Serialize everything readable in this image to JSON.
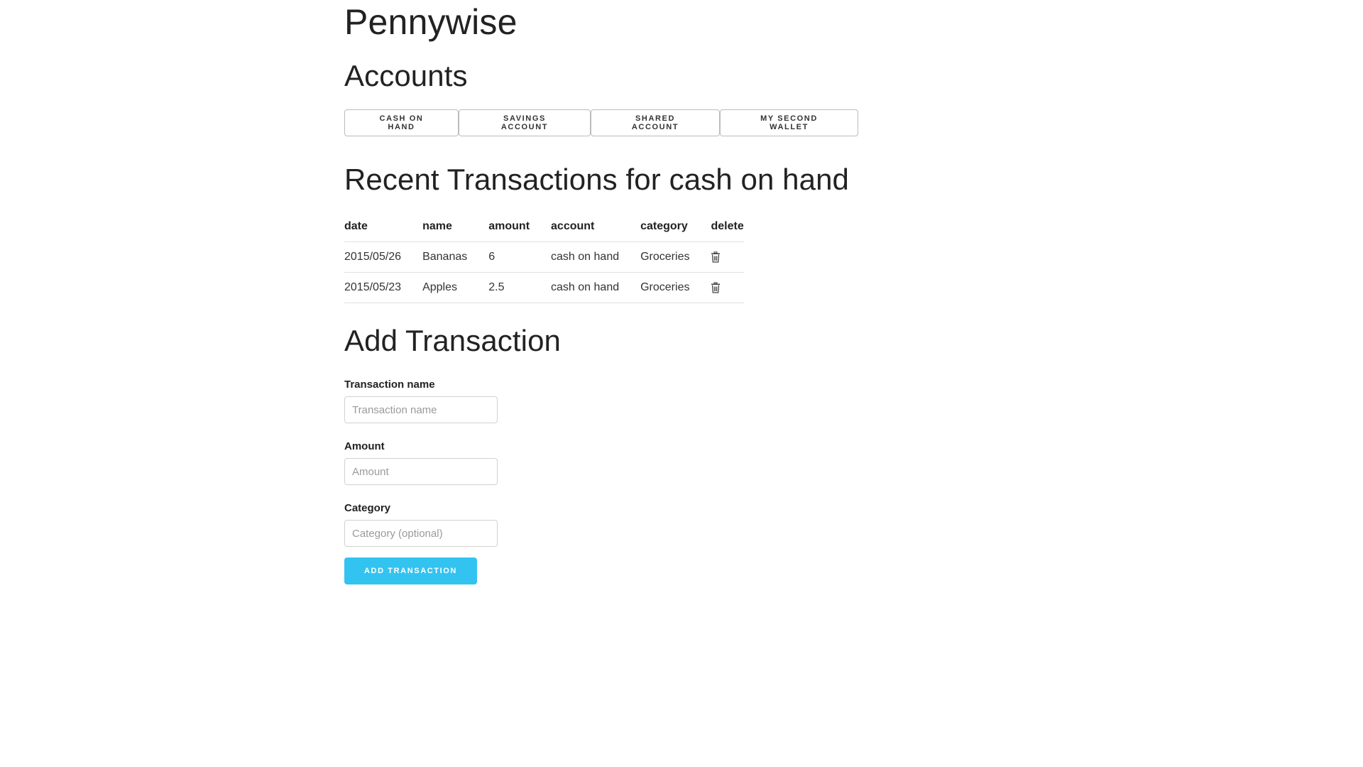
{
  "app": {
    "title": "Pennywise"
  },
  "accounts": {
    "heading": "Accounts",
    "buttons": [
      {
        "label": "CASH ON HAND"
      },
      {
        "label": "SAVINGS ACCOUNT"
      },
      {
        "label": "SHARED ACCOUNT"
      },
      {
        "label": "MY SECOND WALLET"
      }
    ]
  },
  "transactions": {
    "heading": "Recent Transactions for cash on hand",
    "columns": [
      "date",
      "name",
      "amount",
      "account",
      "category",
      "delete"
    ],
    "rows": [
      {
        "date": "2015/05/26",
        "name": "Bananas",
        "amount": "6",
        "account": "cash on hand",
        "category": "Groceries",
        "delete_icon": "trash-icon"
      },
      {
        "date": "2015/05/23",
        "name": "Apples",
        "amount": "2.5",
        "account": "cash on hand",
        "category": "Groceries",
        "delete_icon": "trash-icon"
      }
    ]
  },
  "add_form": {
    "heading": "Add Transaction",
    "name_label": "Transaction name",
    "name_placeholder": "Transaction name",
    "name_value": "",
    "amount_label": "Amount",
    "amount_placeholder": "Amount",
    "amount_value": "",
    "category_label": "Category",
    "category_placeholder": "Category (optional)",
    "category_value": "",
    "submit_label": "ADD TRANSACTION"
  },
  "colors": {
    "primary": "#33c3f0",
    "border": "#bbbbbb",
    "rule": "#e1e1e1",
    "text": "#222222"
  }
}
